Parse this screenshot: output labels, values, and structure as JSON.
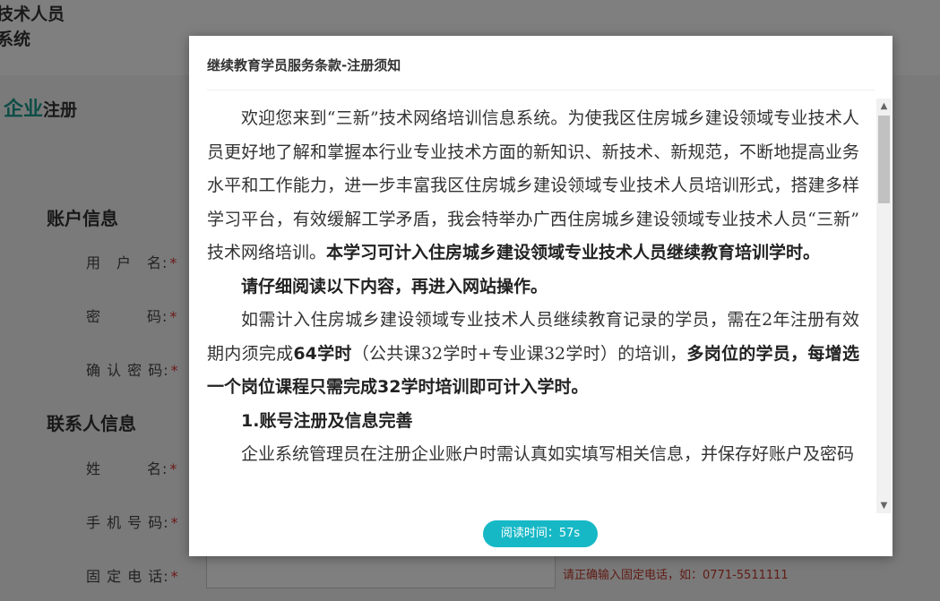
{
  "page": {
    "system_title": "技术人员\n系统",
    "register_accent": "企业",
    "register_title": "注册",
    "account_section": "账户信息",
    "username_label": "用　户　名:",
    "password_label": "密　　　码:",
    "confirm_label": "确 认 密 码:",
    "contact_section": "联系人信息",
    "name_label": "姓　　　名:",
    "phone_label": "手 机 号 码:",
    "landline_label": "固 定 电 话:",
    "required_mark": "*",
    "landline_hint": "请正确输入固定电话，如：0771-5511111"
  },
  "modal": {
    "title": "继续教育学员服务条款-注册须知",
    "p1_text": "欢迎您来到“三新”技术网络培训信息系统。为使我区住房城乡建设领域专业技术人员更好地了解和掌握本行业专业技术方面的新知识、新技术、新规范，不断地提高业务水平和工作能力，进一步丰富我区住房城乡建设领域专业技术人员培训形式，搭建多样学习平台，有效缓解工学矛盾，我会特举办广西住房城乡建设领域专业技术人员“三新” 技术网络培训。",
    "p1_bold": "本学习可计入住房城乡建设领域专业技术人员继续教育培训学时。",
    "p2_bold": "请仔细阅读以下内容，再进入网站操作。",
    "p3_a": "如需计入住房城乡建设领域专业技术人员继续教育记录的学员，需在2年注册有效期内须完成",
    "p3_b": "64学时",
    "p3_c": "（公共课32学时+专业课32学时）的培训，",
    "p3_d": "多岗位的学员，每增选一个岗位课程只需完成32学时培训即可计入学时。",
    "p4_heading": "1.账号注册及信息完善",
    "p5_text": "企业系统管理员在注册企业账户时需认真如实填写相关信息，并保存好账户及密码",
    "timer_label": "阅读时间：57s"
  }
}
